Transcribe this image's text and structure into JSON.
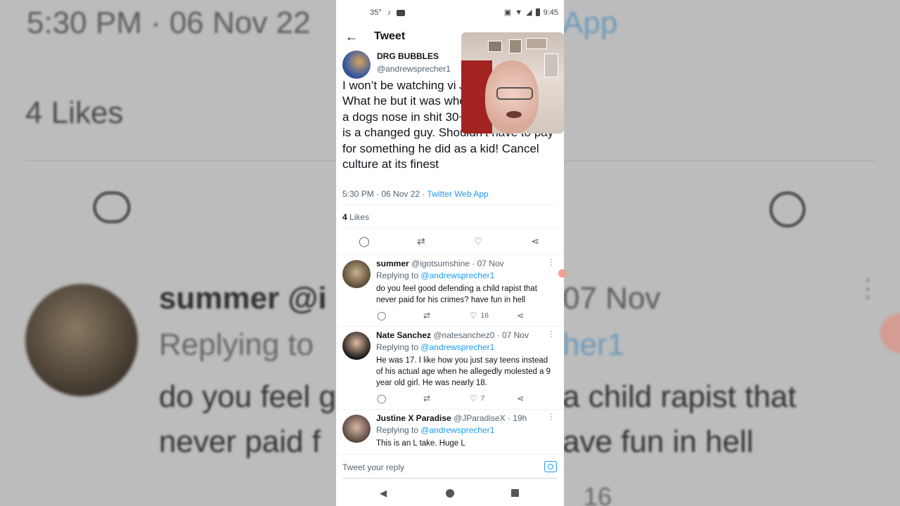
{
  "background": {
    "line1_left": "5:30 PM · 06 Nov 22",
    "line1_right": "App",
    "likes_bg": "4 Likes",
    "reply_name_bg": "summer @i",
    "reply_date_bg": "07 Nov",
    "replying_bg": "Replying to",
    "replying_handle_bg": "her1",
    "text1_left": "do you feel g",
    "text1_right": "a child rapist that",
    "text2_left": "never paid f",
    "text2_right": "ave fun in hell",
    "like_count_bg": "16"
  },
  "status_bar": {
    "temp": "35°",
    "time": "9:45"
  },
  "app_bar": {
    "title": "Tweet"
  },
  "tweet": {
    "display_name": "DRG BUBBLES",
    "handle": "@andrewsprecher1",
    "body": "I won’t be watching vi Jared Leisek. What he but it was when he wa don’t rub a dogs nose in shit 30+ years later! Dude is a changed guy. Shouldn’t have to pay for something he did as a kid! Cancel culture at its finest",
    "timestamp": "5:30 PM · 06 Nov 22 · ",
    "source": "Twitter Web App",
    "likes_count": "4",
    "likes_label": "Likes"
  },
  "replies": [
    {
      "name": "summer",
      "handle": "@igotsumshine",
      "date": "· 07 Nov",
      "replying_prefix": "Replying to",
      "replying_to": "@andrewsprecher1",
      "text": "do you feel good defending a child rapist that never paid for his crimes? have fun in hell",
      "likes": "16"
    },
    {
      "name": "Nate Sanchez",
      "handle": "@natesanchez0",
      "date": "· 07 Nov",
      "replying_prefix": "Replying to",
      "replying_to": "@andrewsprecher1",
      "text": "He was 17. I like how you just say teens instead of his actual age when he allegedly molested a 9 year old girl. He was nearly 18.",
      "likes": "7"
    },
    {
      "name": "Justine X Paradise",
      "handle": "@JParadiseX",
      "date": "· 19h",
      "replying_prefix": "Replying to",
      "replying_to": "@andrewsprecher1",
      "text": "This is an L take. Huge L",
      "likes": ""
    }
  ],
  "compose": {
    "placeholder": "Tweet your reply"
  },
  "colors": {
    "accent": "#1d9bf0",
    "text": "#0f1419",
    "muted": "#536471"
  }
}
